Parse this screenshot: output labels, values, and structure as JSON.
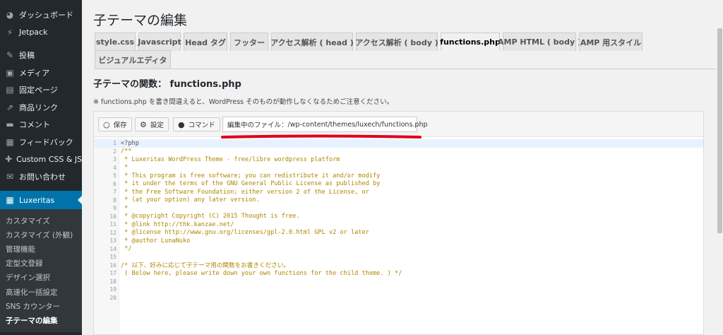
{
  "sidebar": {
    "items": [
      {
        "label": "ダッシュボード",
        "icon": "dashboard-icon",
        "glyph": "◕"
      },
      {
        "label": "Jetpack",
        "icon": "jetpack-icon",
        "glyph": "⚡"
      },
      {
        "label": "投稿",
        "icon": "pin-icon",
        "glyph": "✎"
      },
      {
        "label": "メディア",
        "icon": "media-icon",
        "glyph": "▣"
      },
      {
        "label": "固定ページ",
        "icon": "page-icon",
        "glyph": "▤"
      },
      {
        "label": "商品リンク",
        "icon": "link-icon",
        "glyph": "⇗"
      },
      {
        "label": "コメント",
        "icon": "comment-icon",
        "glyph": "▬"
      },
      {
        "label": "フィードバック",
        "icon": "feedback-icon",
        "glyph": "▦"
      },
      {
        "label": "Custom CSS & JS",
        "icon": "plus-icon",
        "glyph": "✚"
      },
      {
        "label": "お問い合わせ",
        "icon": "mail-icon",
        "glyph": "✉"
      }
    ],
    "active": {
      "label": "Luxeritas",
      "icon": "grid-icon",
      "glyph": "▦"
    },
    "submenu": [
      "カスタマイズ",
      "カスタマイズ (外観)",
      "管理機能",
      "定型文登録",
      "デザイン選択",
      "高速化一括設定",
      "SNS カウンター",
      "子テーマの編集"
    ]
  },
  "page": {
    "title": "子テーマの編集",
    "section_label": "子テーマの関数：",
    "section_file": "functions.php",
    "notice": "※ functions.php を書き間違えると、WordPress そのものが動作しなくなるためご注意ください。"
  },
  "tabs": [
    "style.css",
    "Javascript",
    "Head タグ",
    "フッター",
    "アクセス解析 ( head )",
    "アクセス解析 ( body )",
    "functions.php",
    "AMP HTML ( body )",
    "AMP 用スタイル",
    "ビジュアルエディタ"
  ],
  "active_tab": "functions.php",
  "toolbar": {
    "save_label": "保存",
    "settings_label": "設定",
    "command_label": "コマンド",
    "file_label": "編集中のファイル：",
    "file_path": "/wp-content/themes/luxech/functions.php"
  },
  "code": {
    "lines": [
      "<?php",
      "/**",
      " * Luxeritas WordPress Theme - free/libre wordpress platform",
      " *",
      " * This program is free software; you can redistribute it and/or modify",
      " * it under the terms of the GNU General Public License as published by",
      " * the Free Software Foundation; either version 2 of the License, or",
      " * (at your option) any later version.",
      " *",
      " * @copyright Copyright (C) 2015 Thought is free.",
      " * @link http://thk.kanzae.net/",
      " * @license http://www.gnu.org/licenses/gpl-2.0.html GPL v2 or later",
      " * @author LunaNuko",
      " */",
      "",
      "/* 以下、好みに応じて子テーマ用の関数をお書きください。",
      " ( Below here, please write down your own functions for the child theme. ) */",
      "",
      "",
      ""
    ]
  },
  "colors": {
    "sidebar_bg": "#23282d",
    "active_bg": "#0073aa",
    "code_comment": "#b08600",
    "annotation_red": "#e0001b"
  }
}
